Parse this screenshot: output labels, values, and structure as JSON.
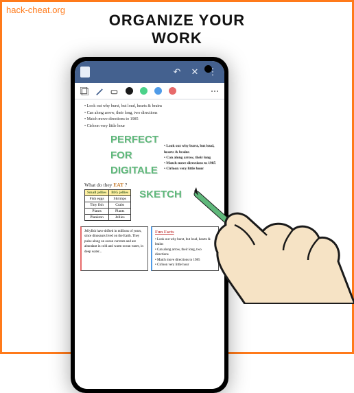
{
  "watermark": "hack-cheat.org",
  "headline_line1": "ORGANIZE YOUR",
  "headline_line2": "WORK",
  "topbar": {
    "doc_label": "document"
  },
  "scribble": {
    "l1": "• Look out why burst, but loud, hearts & brains",
    "l2": "• Can along arrow, their long, two directions",
    "l3": "• Match move directions to 1985",
    "l4": "• Cirloon very little hour"
  },
  "hero": {
    "l1": "PERFECT",
    "l2": "FOR",
    "l3": "DIGITALE"
  },
  "hero_side": {
    "s1": "• Look out why burst, but loud, hearts & brains",
    "s2": "• Can along arrow, their long",
    "s3": "• Match move directions to 1985",
    "s4": "• Cirloon very little hour"
  },
  "table": {
    "question_pre": "What do they ",
    "question_hl": "EAT",
    "question_post": " ?",
    "h1": "Small jellies",
    "h2": "BIG jellies",
    "r1c1": "Fish eggs",
    "r1c2": "Shrimps",
    "r2c1": "Tiny fish",
    "r2c2": "Crabs",
    "r3c1": "Plants",
    "r3c2": "Plants",
    "r4c1": "Plankton",
    "r4c2": "Jellies"
  },
  "sketch_word": "SKETCH",
  "panel_left": {
    "body": "Jellyfish have drifted in millions of years, since dinosaurs lived on the Earth. They pulse along on ocean currents and are abundant in cold and warm ocean water, in deep water..."
  },
  "panel_right": {
    "title": "Fun Facts",
    "f1": "• Look out why burst, but loud, hearts & brains",
    "f2": "• Can along arrow, their long, two directions",
    "f3": "• Match move directions to 1985",
    "f4": "• Cirloon very little hour"
  }
}
